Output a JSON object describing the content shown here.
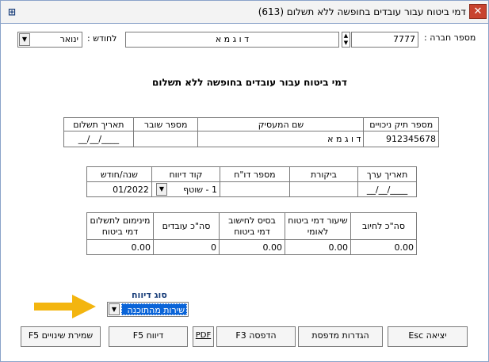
{
  "window": {
    "title": "דמי ביטוח עבור עובדים בחופשה ללא תשלום (613)",
    "close_label": "✕"
  },
  "header": {
    "company_number_label": "מספר חברה :",
    "company_number_value": "7777",
    "company_name_value": "ד ו ג מ א",
    "month_label": "לחודש :",
    "month_value": "ינואר"
  },
  "form_heading": "דמי ביטוח עבור עובדים בחופשה ללא תשלום",
  "table1": {
    "headers": [
      "מספר תיק ניכויים",
      "שם המעסיק",
      "מספר שובר",
      "תאריך תשלום"
    ],
    "values": [
      "912345678",
      "ד ו ג מ א",
      "",
      "__/__/____"
    ]
  },
  "table2": {
    "headers": [
      "תאריך ערך",
      "ביקורת",
      "מספר דו\"ח",
      "קוד דיווח",
      "שנה/חודש"
    ],
    "values": [
      "__/__/____",
      "",
      "",
      "1 - שוטף",
      "01/2022"
    ]
  },
  "table3": {
    "headers": [
      "סה\"כ לחיוב",
      "שיעור דמי ביטוח לאומי",
      "בסיס לחישוב דמי ביטוח",
      "סה\"כ עובדים",
      "מינימום לתשלום דמי ביטוח"
    ],
    "values": [
      "0.00",
      "0.00",
      "0.00",
      "0",
      "0.00"
    ]
  },
  "report_type": {
    "label": "סוג דיווח",
    "value": "שירות מהתוכנה"
  },
  "buttons": {
    "exit": "יציאה Esc",
    "printer_settings": "הגדרות מדפסת",
    "print": "הדפסה F3",
    "pdf": "PDF",
    "report": "דיווח F5",
    "save": "שמירת שינויים F5"
  },
  "colors": {
    "arrow": "#f3b50f",
    "close_button": "#c8432f",
    "selected_highlight": "#0a64d8"
  }
}
